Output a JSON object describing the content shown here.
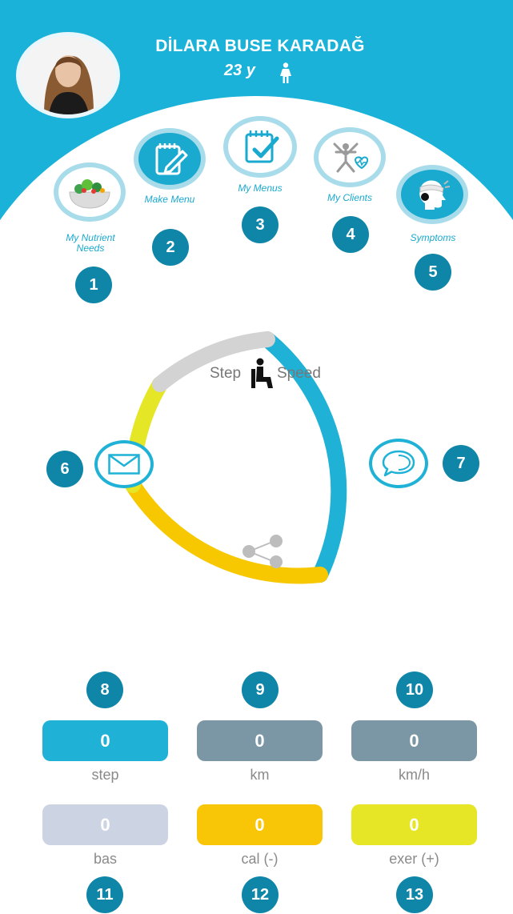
{
  "profile": {
    "name": "DİLARA BUSE KARADAĞ",
    "age": "23 y"
  },
  "nav": [
    {
      "label": "My Nutrient Needs",
      "badge": "1",
      "icon": "salad-bowl-icon"
    },
    {
      "label": "Make Menu",
      "badge": "2",
      "icon": "notepad-pencil-icon"
    },
    {
      "label": "My Menus",
      "badge": "3",
      "icon": "notepad-check-icon"
    },
    {
      "label": "My Clients",
      "badge": "4",
      "icon": "activity-heart-icon"
    },
    {
      "label": "Symptoms",
      "badge": "5",
      "icon": "head-bandage-icon"
    }
  ],
  "ring": {
    "mode_left": "Step",
    "mode_right": "Speed",
    "mail_badge": "6",
    "chat_badge": "7",
    "colors": {
      "blue": "#1fb2d6",
      "yellow_orange": "#f7c800",
      "yellow": "#e5e626",
      "gray": "#d3d3d3"
    }
  },
  "stats": [
    {
      "badge": "8",
      "value": "0",
      "label": "step",
      "color": "#1fb2d6"
    },
    {
      "badge": "9",
      "value": "0",
      "label": "km",
      "color": "#7b97a5"
    },
    {
      "badge": "10",
      "value": "0",
      "label": "km/h",
      "color": "#7b97a5"
    },
    {
      "badge": "11",
      "value": "0",
      "label": "bas",
      "color": "#ccd4e4"
    },
    {
      "badge": "12",
      "value": "0",
      "label": "cal (-)",
      "color": "#f8c606"
    },
    {
      "badge": "13",
      "value": "0",
      "label": "exer (+)",
      "color": "#e6e626"
    }
  ]
}
